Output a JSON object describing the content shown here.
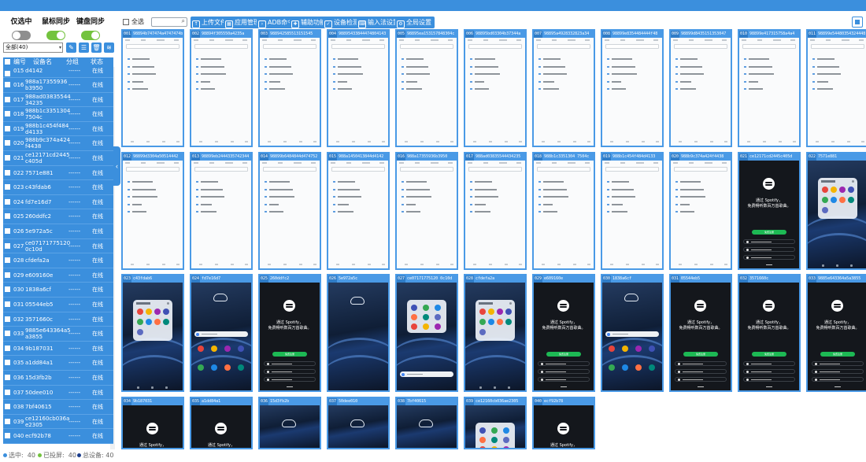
{
  "sync": [
    {
      "label": "仅选中",
      "on": false
    },
    {
      "label": "鼠标同步",
      "on": true
    },
    {
      "label": "键盘同步",
      "on": true
    }
  ],
  "filter": {
    "value": "全部(40)",
    "chevron": "▾"
  },
  "sidebar_tools": [
    {
      "icon": "edit-icon",
      "glyph": "✎"
    },
    {
      "icon": "list-edit-icon",
      "glyph": "☰"
    },
    {
      "icon": "trash-icon",
      "glyph": "🗑"
    },
    {
      "icon": "wifi-icon",
      "glyph": "≋"
    }
  ],
  "device_table": {
    "columns": [
      "编号",
      "设备名",
      "分组",
      "状态"
    ],
    "rows": [
      {
        "num": "015",
        "name": "d4142",
        "group": "------",
        "status": "在线",
        "partial": true
      },
      {
        "num": "016",
        "name": "988a17355936\nb3950",
        "group": "------",
        "status": "在线"
      },
      {
        "num": "017",
        "name": "988ad03835544\n34235",
        "group": "------",
        "status": "在线"
      },
      {
        "num": "018",
        "name": "988b1c3351304\n7504c",
        "group": "------",
        "status": "在线"
      },
      {
        "num": "019",
        "name": "988b1c454f484\nd4133",
        "group": "------",
        "status": "在线"
      },
      {
        "num": "020",
        "name": "988b9c374a424\nf4438",
        "group": "------",
        "status": "在线"
      },
      {
        "num": "021",
        "name": "ce12171cd2445\nc405d",
        "group": "------",
        "status": "在线"
      },
      {
        "num": "022",
        "name": "7571e881",
        "group": "------",
        "status": "在线"
      },
      {
        "num": "023",
        "name": "c43fdab6",
        "group": "------",
        "status": "在线"
      },
      {
        "num": "024",
        "name": "fd7e16d7",
        "group": "------",
        "status": "在线"
      },
      {
        "num": "025",
        "name": "260ddfc2",
        "group": "------",
        "status": "在线"
      },
      {
        "num": "026",
        "name": "5e972a5c",
        "group": "------",
        "status": "在线"
      },
      {
        "num": "027",
        "name": "ce07171775120\n0c10d",
        "group": "------",
        "status": "在线"
      },
      {
        "num": "028",
        "name": "cfdefa2a",
        "group": "------",
        "status": "在线"
      },
      {
        "num": "029",
        "name": "e609160e",
        "group": "------",
        "status": "在线"
      },
      {
        "num": "030",
        "name": "1838a6cf",
        "group": "------",
        "status": "在线"
      },
      {
        "num": "031",
        "name": "05544eb5",
        "group": "------",
        "status": "在线"
      },
      {
        "num": "032",
        "name": "3571660c",
        "group": "------",
        "status": "在线"
      },
      {
        "num": "033",
        "name": "9885e643364a5\na3855",
        "group": "------",
        "status": "在线"
      },
      {
        "num": "034",
        "name": "9b187031",
        "group": "------",
        "status": "在线"
      },
      {
        "num": "035",
        "name": "a1dd84a1",
        "group": "------",
        "status": "在线"
      },
      {
        "num": "036",
        "name": "15d3fb2b",
        "group": "------",
        "status": "在线"
      },
      {
        "num": "037",
        "name": "50dee010",
        "group": "------",
        "status": "在线"
      },
      {
        "num": "038",
        "name": "7bf40615",
        "group": "------",
        "status": "在线"
      },
      {
        "num": "039",
        "name": "ce12160cb036a\ne2305",
        "group": "------",
        "status": "在线"
      },
      {
        "num": "040",
        "name": "ecf92b78",
        "group": "------",
        "status": "在线"
      }
    ]
  },
  "footer": {
    "selected_label": "选中:",
    "selected": "40",
    "connected_label": "已投屏:",
    "connected": "40",
    "total_label": "总设备:",
    "total": "40"
  },
  "toolbar": {
    "select_all": "全选",
    "buttons": [
      "上传文件",
      "应用管理",
      "ADB命令",
      "辅助功能",
      "设备检测",
      "输入法设置",
      "全局设置"
    ]
  },
  "colors": {
    "accent": "#3b8fdd",
    "toggle_on": "#73c33e",
    "toggle_off": "#8e8e8e",
    "spotify_green": "#1db954"
  },
  "spotify": {
    "line1": "通过 Spotify，",
    "line2": "免费畅听数百万首歌曲。",
    "signup": "免费注册"
  },
  "cards": [
    {
      "id": "001",
      "name": "98894b747474a4747474b",
      "screen": "light"
    },
    {
      "id": "002",
      "name": "98894f305550a4235a",
      "screen": "light"
    },
    {
      "id": "003",
      "name": "988942585513151545",
      "screen": "light"
    },
    {
      "id": "004",
      "name": "98895433844474804143",
      "screen": "light"
    },
    {
      "id": "005",
      "name": "98895ea153157848304c",
      "screen": "light"
    },
    {
      "id": "006",
      "name": "98895bd03304b37344a",
      "screen": "light"
    },
    {
      "id": "007",
      "name": "98895a4928332823a34",
      "screen": "light"
    },
    {
      "id": "008",
      "name": "98899e8354484444f48",
      "screen": "light"
    },
    {
      "id": "009",
      "name": "98899d8435151353047",
      "screen": "light"
    },
    {
      "id": "010",
      "name": "98899e417315758a4a4",
      "screen": "light"
    },
    {
      "id": "011",
      "name": "98899e54480354324448",
      "screen": "light"
    },
    {
      "id": "012",
      "name": "98899d3304a50514442",
      "screen": "light"
    },
    {
      "id": "013",
      "name": "98899eb2444335742344",
      "screen": "light"
    },
    {
      "id": "014",
      "name": "98899b6484844d474752",
      "screen": "light"
    },
    {
      "id": "015",
      "name": "988a1450413844d4142",
      "screen": "light"
    },
    {
      "id": "016",
      "name": "988a17355936b3950",
      "screen": "light"
    },
    {
      "id": "017",
      "name": "988ad03835544434235",
      "screen": "light"
    },
    {
      "id": "018",
      "name": "988b1c3351304 7504c",
      "screen": "light"
    },
    {
      "id": "019",
      "name": "988b1c454f484d4133",
      "screen": "light"
    },
    {
      "id": "020",
      "name": "988b9c374a424f4438",
      "screen": "light"
    },
    {
      "id": "021",
      "name": "ce12171cd2445c405d",
      "screen": "spotify"
    },
    {
      "id": "022",
      "name": "7571e881",
      "screen": "samsung"
    },
    {
      "id": "023",
      "name": "c43fdab6",
      "screen": "samsung"
    },
    {
      "id": "024",
      "name": "fd7e16d7",
      "screen": "galaxy-google"
    },
    {
      "id": "025",
      "name": "260ddfc2",
      "screen": "spotify"
    },
    {
      "id": "026",
      "name": "5e972a5c",
      "screen": "galaxy"
    },
    {
      "id": "027",
      "name": "ce07171775120 0c10d",
      "screen": "google"
    },
    {
      "id": "028",
      "name": "cfdefa2a",
      "screen": "samsung"
    },
    {
      "id": "029",
      "name": "e609160e",
      "screen": "spotify"
    },
    {
      "id": "030",
      "name": "1838a6cf",
      "screen": "galaxy-google"
    },
    {
      "id": "031",
      "name": "05544eb5",
      "screen": "spotify"
    },
    {
      "id": "032",
      "name": "3571660c",
      "screen": "spotify"
    },
    {
      "id": "033",
      "name": "9885e643364a5a3855",
      "screen": "spotify"
    },
    {
      "id": "034",
      "name": "9b187031",
      "screen": "spotify"
    },
    {
      "id": "035",
      "name": "a1dd84a1",
      "screen": "spotify"
    },
    {
      "id": "036",
      "name": "15d3fb2b",
      "screen": "galaxy"
    },
    {
      "id": "037",
      "name": "50dee010",
      "screen": "galaxy"
    },
    {
      "id": "038",
      "name": "7bf40615",
      "screen": "galaxy"
    },
    {
      "id": "039",
      "name": "ce12160cb036ae2305",
      "screen": "google"
    },
    {
      "id": "040",
      "name": "ecf92b78",
      "screen": "spotify"
    }
  ]
}
